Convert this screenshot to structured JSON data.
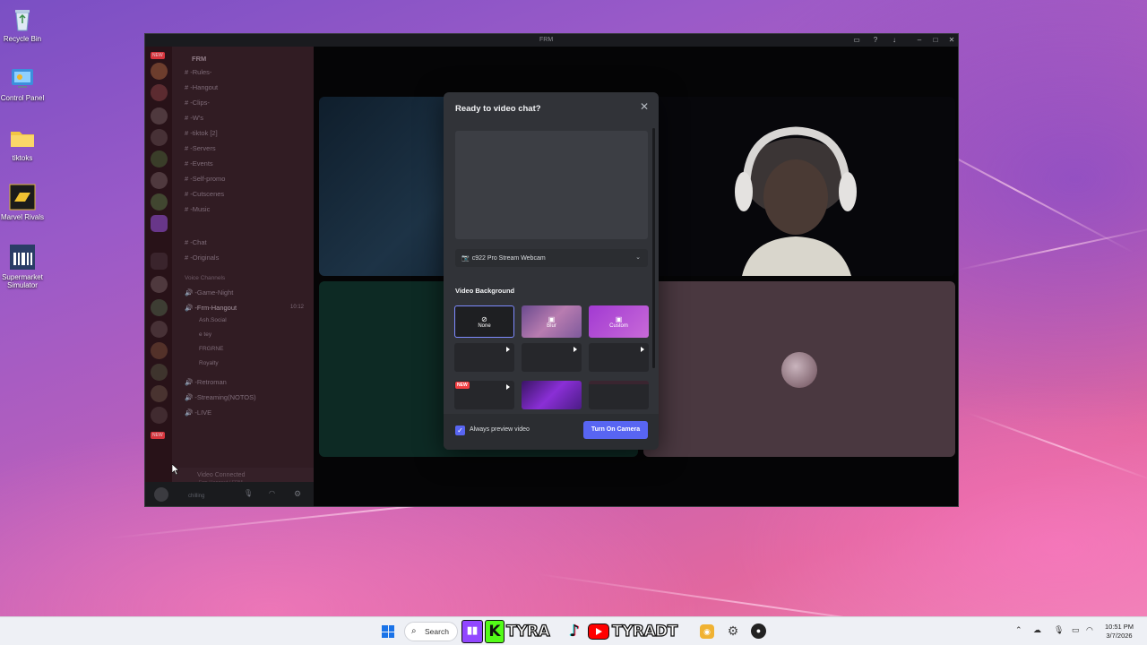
{
  "desktop": {
    "icons": [
      {
        "label": "Recycle Bin"
      },
      {
        "label": "Control Panel"
      },
      {
        "label": "tiktoks"
      },
      {
        "label": "Marvel Rivals"
      },
      {
        "label": "Supermarket Simulator"
      }
    ]
  },
  "window": {
    "title": "FRM",
    "controls": {
      "minimize": "–",
      "maximize": "□",
      "close": "✕"
    }
  },
  "discord": {
    "server_name": "FRM",
    "badges": {
      "new_top": "NEW",
      "new_bottom": "NEW"
    },
    "channels": [
      {
        "label": "# -Rules-"
      },
      {
        "label": "# -Hangout"
      },
      {
        "label": "# -Clips-"
      },
      {
        "label": "# -W's"
      },
      {
        "label": "# -tiktok [2]"
      },
      {
        "label": "# -Servers"
      },
      {
        "label": "# -Events"
      },
      {
        "label": "# -Self-promo"
      },
      {
        "label": "# -Cutscenes"
      },
      {
        "label": "# -Music"
      }
    ],
    "channels2": [
      {
        "label": "# -Chat"
      },
      {
        "label": "# -Originals"
      }
    ],
    "voice_category": "Voice Channels",
    "voice_channels": [
      {
        "label": "🔊 -Game-Night"
      },
      {
        "label": "🔊 -Frm-Hangout",
        "count": "10:12"
      }
    ],
    "voice_users": [
      {
        "label": "Ash.Social"
      },
      {
        "label": "e tey"
      },
      {
        "label": "FRGRNE"
      },
      {
        "label": "Royalty"
      }
    ],
    "voice_channels_after": [
      {
        "label": "🔊 -Retroman"
      },
      {
        "label": "🔊 -Streaming(NOTOS)"
      },
      {
        "label": "🔊 -LIVE"
      }
    ],
    "voice_status": {
      "title": "Video Connected",
      "subtitle": "-Frm-Hangout / FRM"
    },
    "user_status": "chilling"
  },
  "modal": {
    "title": "Ready to video chat?",
    "camera_select": "c922 Pro Stream Webcam",
    "video_background_label": "Video Background",
    "bg_options": [
      {
        "label": "None",
        "icon": "⊘"
      },
      {
        "label": "Blur",
        "icon": "▣"
      },
      {
        "label": "Custom",
        "icon": "▣"
      }
    ],
    "new_badge": "NEW",
    "always_preview_label": "Always preview video",
    "always_preview_checked": true,
    "turn_on_button": "Turn On Camera"
  },
  "taskbar": {
    "search_label": "Search",
    "brand_text_1": "TYRA",
    "brand_text_2": "TYRADT",
    "clock_time": "10:51 PM",
    "clock_date": "3/7/2026"
  },
  "colors": {
    "accent": "#5865f2",
    "modal_bg": "#313338",
    "danger": "#f23f43"
  }
}
